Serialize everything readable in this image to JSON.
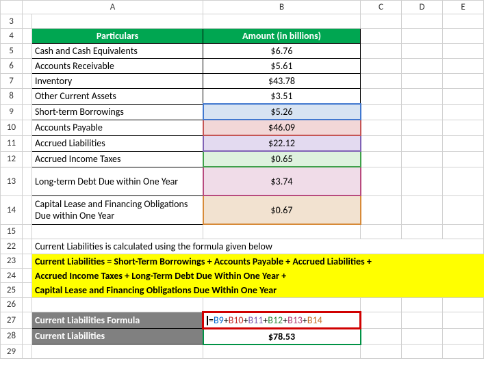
{
  "columns": [
    "",
    "A",
    "B",
    "C",
    "D",
    "E"
  ],
  "row_labels": [
    "3",
    "4",
    "5",
    "6",
    "7",
    "8",
    "9",
    "10",
    "11",
    "12",
    "13",
    "14",
    "15",
    "22",
    "23",
    "24",
    "25",
    "26",
    "27",
    "28",
    "29"
  ],
  "header": {
    "particulars": "Particulars",
    "amount": "Amount (in billions)"
  },
  "rows": {
    "r5": {
      "label": "Cash and Cash Equivalents",
      "value": "$6.76"
    },
    "r6": {
      "label": "Accounts Receivable",
      "value": "$5.61"
    },
    "r7": {
      "label": "Inventory",
      "value": "$43.78"
    },
    "r8": {
      "label": "Other Current Assets",
      "value": "$3.51"
    },
    "r9": {
      "label": "Short-term Borrowings",
      "value": "$5.26"
    },
    "r10": {
      "label": "Accounts Payable",
      "value": "$46.09"
    },
    "r11": {
      "label": "Accrued Liabilities",
      "value": "$22.12"
    },
    "r12": {
      "label": "Accrued Income Taxes",
      "value": "$0.65"
    },
    "r13": {
      "label": "Long-term Debt Due within One Year",
      "value": "$3.74"
    },
    "r14": {
      "label": "Capital Lease and Financing Obligations Due within One Year",
      "value": "$0.67"
    }
  },
  "note": "Current Liabilities is calculated using the formula given below",
  "formula_text": {
    "l1": "Current Liabilities = Short-Term Borrowings + Accounts Payable + Accrued Liabilities +",
    "l2": "Accrued Income Taxes + Long-Term Debt Due Within One Year +",
    "l3": "Capital Lease and Financing Obligations Due Within One Year"
  },
  "result": {
    "formula_label": "Current Liabilities Formula",
    "value_label": "Current Liabilities",
    "value": "$78.53"
  },
  "formula_parts": {
    "eq": "=",
    "b9": "B9",
    "b10": "B10",
    "b11": "B11",
    "b12": "B12",
    "b13": "B13",
    "b14": "B14",
    "plus": "+"
  },
  "chart_data": {
    "type": "table",
    "title": "Current Liabilities Calculation",
    "categories": [
      "Short-term Borrowings",
      "Accounts Payable",
      "Accrued Liabilities",
      "Accrued Income Taxes",
      "Long-term Debt Due within One Year",
      "Capital Lease and Financing Obligations Due within One Year"
    ],
    "values": [
      5.26,
      46.09,
      22.12,
      0.65,
      3.74,
      0.67
    ],
    "total": 78.53,
    "unit": "$ billions"
  }
}
